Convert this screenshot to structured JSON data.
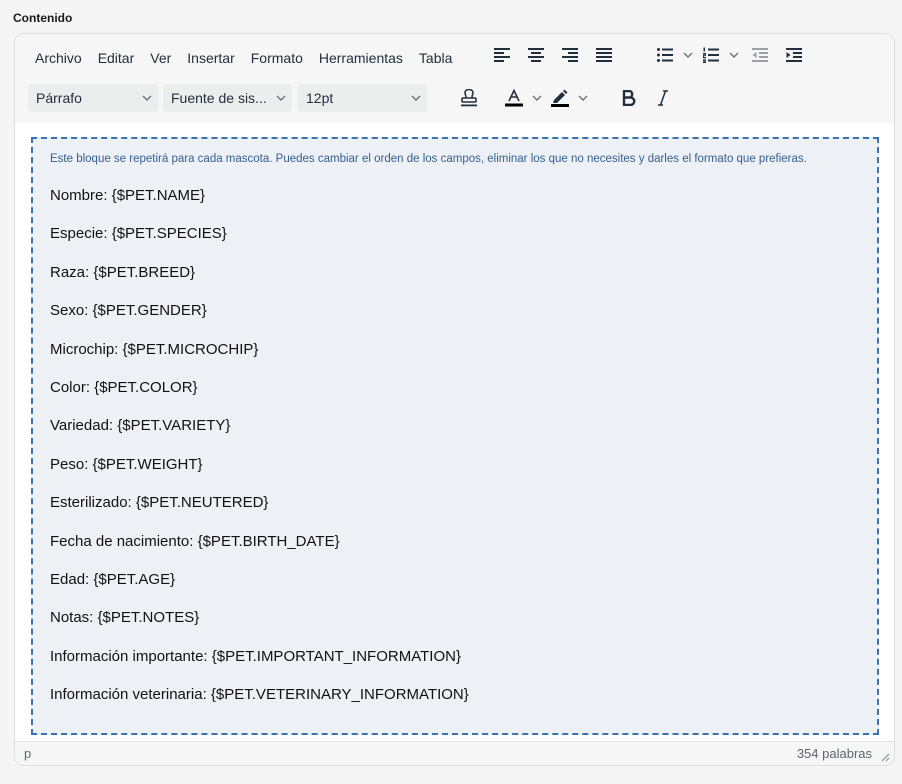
{
  "field_label": "Contenido",
  "menubar": [
    "Archivo",
    "Editar",
    "Ver",
    "Insertar",
    "Formato",
    "Herramientas",
    "Tabla"
  ],
  "selects": {
    "block_format": "Párrafo",
    "font_family": "Fuente de sis...",
    "font_size": "12pt"
  },
  "toolbar_icons": {
    "align": [
      "align-left-icon",
      "align-center-icon",
      "align-right-icon",
      "align-justify-icon"
    ],
    "lists": [
      "bullet-list-icon",
      "numbered-list-icon",
      "outdent-icon",
      "indent-icon"
    ],
    "format": [
      "stamp-icon",
      "text-color-icon",
      "highlight-icon",
      "bold-icon",
      "italic-icon"
    ]
  },
  "colors": {
    "text_color_swatch": "#000000",
    "highlight_swatch": "#000000",
    "block_border": "#3a73ad",
    "block_background": "#edf1f6",
    "hint_text": "#335f8e"
  },
  "content": {
    "hint": "Este bloque se repetirá para cada mascota. Puedes cambiar el orden de los campos, eliminar los que no necesites y darles el formato que prefieras.",
    "lines": [
      "Nombre: {$PET.NAME}",
      "Especie: {$PET.SPECIES}",
      "Raza: {$PET.BREED}",
      "Sexo: {$PET.GENDER}",
      "Microchip: {$PET.MICROCHIP}",
      "Color: {$PET.COLOR}",
      "Variedad: {$PET.VARIETY}",
      "Peso: {$PET.WEIGHT}",
      "Esterilizado: {$PET.NEUTERED}",
      "Fecha de nacimiento: {$PET.BIRTH_DATE}",
      "Edad: {$PET.AGE}",
      "Notas: {$PET.NOTES}",
      "Información importante: {$PET.IMPORTANT_INFORMATION}",
      "Información veterinaria: {$PET.VETERINARY_INFORMATION}"
    ]
  },
  "statusbar": {
    "path": "p",
    "word_count": "354 palabras"
  }
}
